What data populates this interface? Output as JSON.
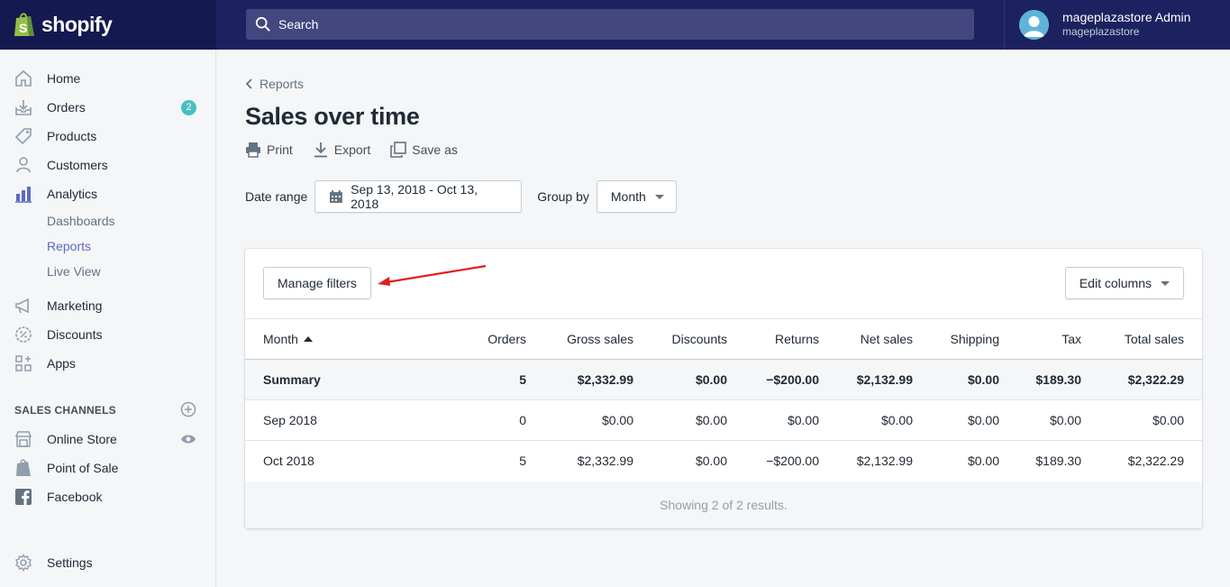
{
  "topbar": {
    "brand": "shopify",
    "search_placeholder": "Search",
    "account_name": "mageplazastore Admin",
    "account_store": "mageplazastore"
  },
  "sidebar": {
    "items": [
      {
        "label": "Home",
        "icon": "home-icon"
      },
      {
        "label": "Orders",
        "icon": "orders-icon",
        "badge": "2"
      },
      {
        "label": "Products",
        "icon": "tag-icon"
      },
      {
        "label": "Customers",
        "icon": "person-icon"
      },
      {
        "label": "Analytics",
        "icon": "analytics-icon"
      }
    ],
    "analytics_sub": [
      "Dashboards",
      "Reports",
      "Live View"
    ],
    "items2": [
      {
        "label": "Marketing",
        "icon": "megaphone-icon"
      },
      {
        "label": "Discounts",
        "icon": "discount-icon"
      },
      {
        "label": "Apps",
        "icon": "apps-icon"
      }
    ],
    "channels_title": "SALES CHANNELS",
    "channels": [
      {
        "label": "Online Store",
        "icon": "store-icon"
      },
      {
        "label": "Point of Sale",
        "icon": "pos-icon"
      },
      {
        "label": "Facebook",
        "icon": "facebook-icon"
      }
    ],
    "settings": "Settings"
  },
  "main": {
    "breadcrumb": "Reports",
    "title": "Sales over time",
    "actions": {
      "print": "Print",
      "export": "Export",
      "save_as": "Save as"
    },
    "date_range_label": "Date range",
    "date_range_value": "Sep 13, 2018 - Oct 13, 2018",
    "group_by_label": "Group by",
    "group_by_value": "Month",
    "manage_filters": "Manage filters",
    "edit_columns": "Edit columns",
    "table": {
      "headers": [
        "Month",
        "Orders",
        "Gross sales",
        "Discounts",
        "Returns",
        "Net sales",
        "Shipping",
        "Tax",
        "Total sales"
      ],
      "summary": [
        "Summary",
        "5",
        "$2,332.99",
        "$0.00",
        "−$200.00",
        "$2,132.99",
        "$0.00",
        "$189.30",
        "$2,322.29"
      ],
      "rows": [
        [
          "Sep 2018",
          "0",
          "$0.00",
          "$0.00",
          "$0.00",
          "$0.00",
          "$0.00",
          "$0.00",
          "$0.00"
        ],
        [
          "Oct 2018",
          "5",
          "$2,332.99",
          "$0.00",
          "−$200.00",
          "$2,132.99",
          "$0.00",
          "$189.30",
          "$2,322.29"
        ]
      ],
      "footer": "Showing 2 of 2 results."
    }
  },
  "colors": {
    "topbar": "#1c2260",
    "accent": "#5c6ac4",
    "badge": "#47c1bf",
    "annotation_arrow": "#e02020"
  }
}
